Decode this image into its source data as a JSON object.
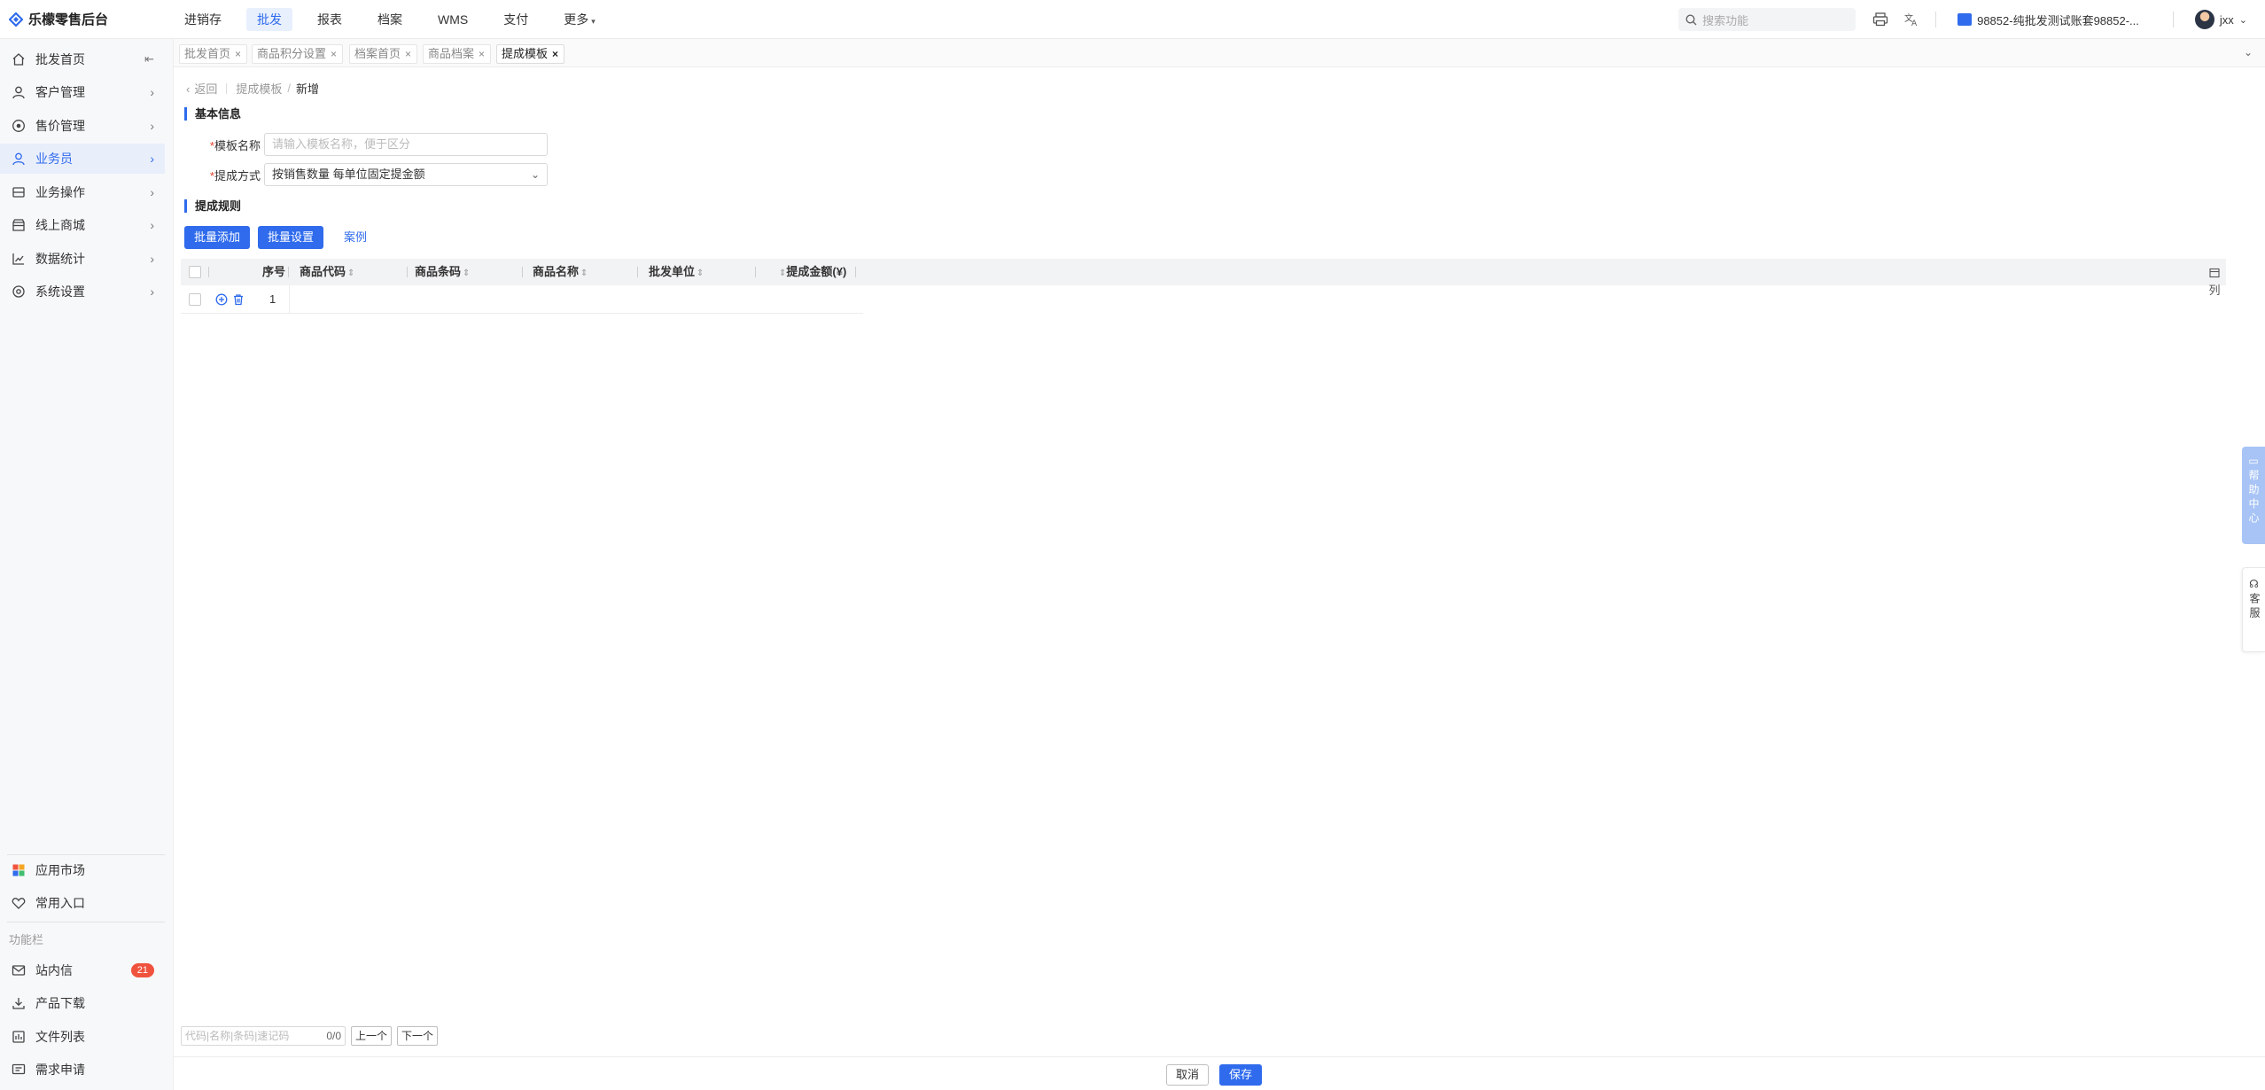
{
  "app": {
    "title": "乐檬零售后台"
  },
  "topnav": {
    "items": [
      "进销存",
      "批发",
      "报表",
      "档案",
      "WMS",
      "支付",
      "更多"
    ],
    "active_index": 1
  },
  "topbar": {
    "search_placeholder": "搜索功能",
    "account": "98852-纯批发测试账套98852-...",
    "username": "jxx"
  },
  "sidebar": {
    "items": [
      {
        "label": "批发首页",
        "icon": "home-icon"
      },
      {
        "label": "客户管理",
        "icon": "user-icon"
      },
      {
        "label": "售价管理",
        "icon": "price-icon"
      },
      {
        "label": "业务员",
        "icon": "person-icon"
      },
      {
        "label": "业务操作",
        "icon": "operation-icon"
      },
      {
        "label": "线上商城",
        "icon": "store-icon"
      },
      {
        "label": "数据统计",
        "icon": "chart-icon"
      },
      {
        "label": "系统设置",
        "icon": "settings-icon"
      }
    ],
    "active_index": 3,
    "bottom_items": [
      {
        "label": "应用市场",
        "icon": "app-market-icon"
      },
      {
        "label": "常用入口",
        "icon": "heart-icon"
      }
    ],
    "section_label": "功能栏",
    "function_items": [
      {
        "label": "站内信",
        "icon": "mail-icon",
        "badge": "21"
      },
      {
        "label": "产品下载",
        "icon": "download-icon"
      },
      {
        "label": "文件列表",
        "icon": "file-list-icon"
      },
      {
        "label": "需求申请",
        "icon": "request-icon"
      }
    ]
  },
  "tabs": [
    {
      "label": "批发首页"
    },
    {
      "label": "商品积分设置"
    },
    {
      "label": "档案首页"
    },
    {
      "label": "商品档案"
    },
    {
      "label": "提成模板"
    }
  ],
  "active_tab_index": 4,
  "breadcrumb": {
    "back": "返回",
    "parent": "提成模板",
    "current": "新增"
  },
  "basic": {
    "title": "基本信息",
    "name_label": "模板名称",
    "name_placeholder": "请输入模板名称，便于区分",
    "method_label": "提成方式",
    "method_value": "按销售数量 每单位固定提金额"
  },
  "rules": {
    "title": "提成规则",
    "batch_add": "批量添加",
    "batch_set": "批量设置",
    "example": "案例"
  },
  "table": {
    "headers": [
      "序号",
      "商品代码",
      "商品条码",
      "商品名称",
      "批发单位",
      "提成金额(¥)"
    ],
    "rows": [
      {
        "index": "1"
      }
    ],
    "column_button": "列"
  },
  "side_widgets": {
    "help": "帮助中心",
    "service": "客服"
  },
  "findbar": {
    "placeholder": "代码|名称|条码|速记码",
    "count": "0/0",
    "prev": "上一个",
    "next": "下一个"
  },
  "footer": {
    "cancel": "取消",
    "save": "保存"
  }
}
